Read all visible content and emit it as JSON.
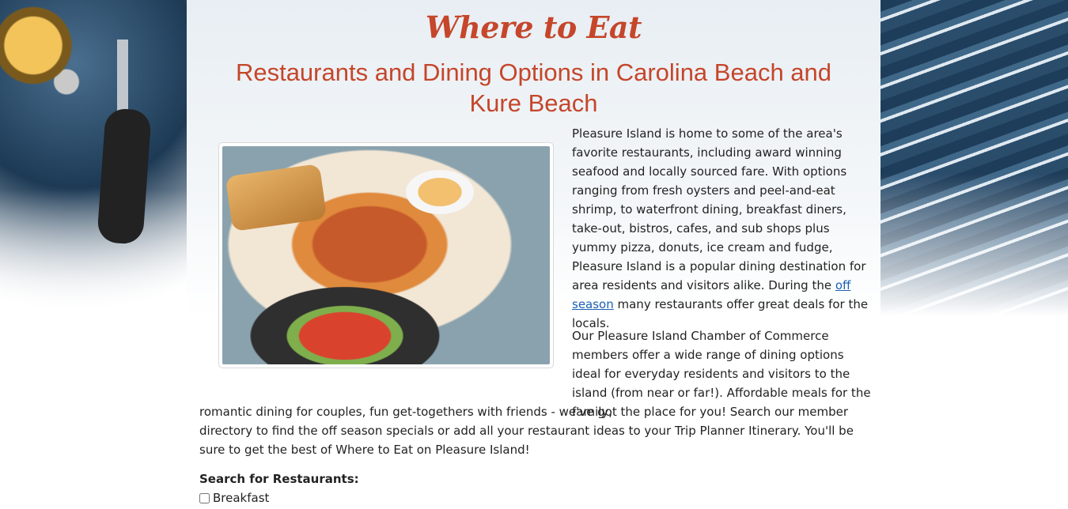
{
  "header": {
    "script_title": "Where to Eat",
    "main_heading": "Restaurants and Dining Options in Carolina Beach and Kure Beach"
  },
  "content": {
    "paragraph1_before_link": "Pleasure Island is home to some of the area's favorite restaurants, including award winning seafood and locally sourced fare. With options ranging from fresh oysters and peel-and-eat shrimp, to waterfront dining, breakfast diners, take-out, bistros, cafes, and sub shops plus yummy pizza, donuts, ice cream and fudge, Pleasure Island is a popular dining destination for area residents and visitors alike. During the ",
    "paragraph1_link": "off season",
    "paragraph1_after_link": " many restaurants offer great deals for the locals.",
    "paragraph2_part1": "Our Pleasure Island Chamber of Commerce members offer a wide range of dining options ideal for everyday residents and visitors to the island (from near or far!). Affordable meals for the family,",
    "paragraph2_part2": "romantic dining for couples, fun get-togethers with friends - we've got the place for you! Search our member directory to find the off season specials or add all your restaurant ideas to your Trip Planner Itinerary. You'll be sure to get the best of Where to Eat on Pleasure Island!"
  },
  "search": {
    "label": "Search for Restaurants:",
    "options": [
      {
        "label": "Breakfast",
        "checked": false
      }
    ]
  },
  "colors": {
    "accent": "#c5462a",
    "link": "#1a5fb4"
  },
  "images": {
    "hero_photo": "seafood-plate-photo",
    "left_panel": "fishing-reel-photo",
    "right_panel": "ocean-waves-photo"
  }
}
